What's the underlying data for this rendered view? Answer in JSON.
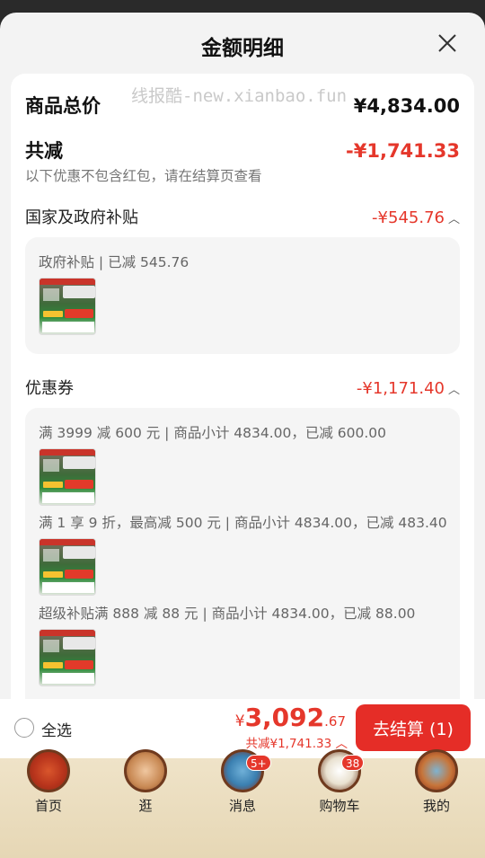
{
  "sheet": {
    "title": "金额明细"
  },
  "watermark": "线报酷-new.xianbao.fun",
  "summary": {
    "goods_total_label": "商品总价",
    "goods_total_value": "¥4,834.00",
    "discount_label": "共减",
    "discount_value": "-¥1,741.33",
    "discount_hint": "以下优惠不包含红包，请在结算页查看"
  },
  "sections": {
    "subsidy": {
      "label": "国家及政府补贴",
      "value": "-¥545.76",
      "items": [
        {
          "text": "政府补贴 | 已减 545.76"
        }
      ]
    },
    "coupon": {
      "label": "优惠券",
      "value": "-¥1,171.40",
      "items": [
        {
          "text": "满 3999 减 600 元 | 商品小计 4834.00，已减 600.00"
        },
        {
          "text": "满 1 享 9 折，最高减 500 元 | 商品小计 4834.00，已减 483.40"
        },
        {
          "text": "超级补贴满 888 减 88 元 | 商品小计 4834.00，已减 88.00"
        }
      ]
    }
  },
  "bottom": {
    "select_all": "全选",
    "currency": "¥",
    "total_int": "3,092",
    "total_dec": ".67",
    "total_sub": "共减¥1,741.33",
    "checkout": "去结算 (1)"
  },
  "tabs": [
    {
      "label": "首页",
      "icon": "home-icon"
    },
    {
      "label": "逛",
      "icon": "browse-icon"
    },
    {
      "label": "消息",
      "icon": "message-icon",
      "badge": "5+"
    },
    {
      "label": "购物车",
      "icon": "cart-icon",
      "badge": "38"
    },
    {
      "label": "我的",
      "icon": "profile-icon"
    }
  ],
  "colors": {
    "accent_red": "#e5372b",
    "checkout_red": "#e52d27"
  }
}
